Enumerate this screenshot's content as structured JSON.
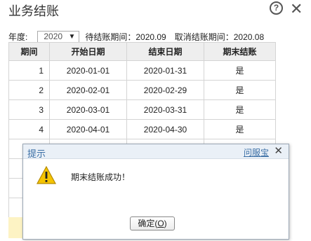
{
  "window": {
    "title": "业务结账"
  },
  "filter": {
    "year_label": "年度:",
    "year_value": "2020",
    "pending_period": "待结账期间：2020.09",
    "cancel_period": "取消结账期间：2020.08"
  },
  "table": {
    "headers": [
      "期间",
      "开始日期",
      "结束日期",
      "期末结账"
    ],
    "rows": [
      [
        "1",
        "2020-01-01",
        "2020-01-31",
        "是"
      ],
      [
        "2",
        "2020-02-01",
        "2020-02-29",
        "是"
      ],
      [
        "3",
        "2020-03-01",
        "2020-03-31",
        "是"
      ],
      [
        "4",
        "2020-04-01",
        "2020-04-30",
        "是"
      ]
    ]
  },
  "dialog": {
    "title": "提示",
    "help_link": "问服宝",
    "close_glyph": "✕",
    "message": "期末结账成功！",
    "ok_label": "确定(",
    "ok_key": "O",
    "ok_label_end": ")"
  },
  "icons": {
    "help": "help-icon",
    "close": "close-icon",
    "warning": "warning-icon"
  },
  "colors": {
    "dialog_title": "#3a6ea5",
    "header_bg": "#eeeeee",
    "highlight_row": "#fdf3c4"
  }
}
